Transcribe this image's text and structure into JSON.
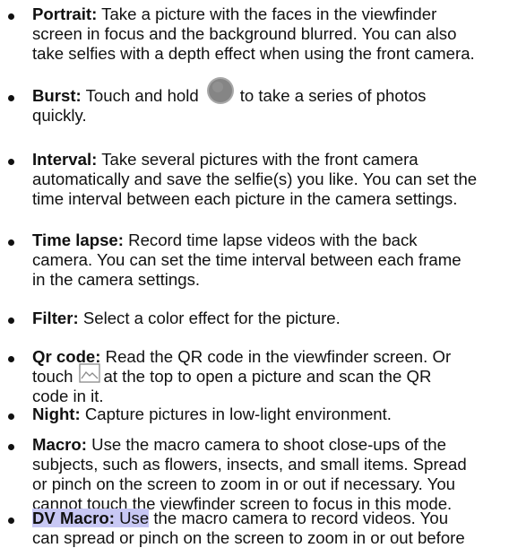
{
  "items": [
    {
      "term": "Portrait:",
      "lines": [
        "Take a picture with the faces in the viewfinder",
        "screen in focus and the background blurred. You can also",
        "take selfies with a depth effect when using the front camera."
      ]
    },
    {
      "term": "Burst:",
      "l1_before": "Touch and hold",
      "icon": "shutter-button-icon",
      "l1_after": "to take a series of photos",
      "l2": "quickly."
    },
    {
      "term": "Interval:",
      "lines": [
        "Take several pictures with the front camera",
        "automatically and save the selfie(s) you like. You can set the",
        "time interval between each picture in the camera settings."
      ]
    },
    {
      "term": "Time lapse:",
      "lines": [
        "Record time lapse videos with the back",
        "camera. You can set the time interval between each frame",
        "in the camera settings."
      ]
    },
    {
      "term": "Filter:",
      "lines": [
        "Select a color effect for the picture."
      ]
    },
    {
      "term": "Qr code:",
      "l1": "Read the QR code in the viewfinder screen. Or",
      "l2_before": "touch",
      "icon": "open-picture-icon",
      "l2_after": "at the top to open a picture and scan the QR",
      "l3": "code in it."
    },
    {
      "term": "Night:",
      "lines": [
        "Capture pictures in low-light environment."
      ]
    },
    {
      "term": "Macro:",
      "lines": [
        "Use the macro camera to shoot close-ups of the",
        "subjects, such as flowers, insects, and small items. Spread",
        "or pinch on the screen to zoom in or out if necessary. You",
        "cannot touch the viewfinder screen to focus in this mode."
      ]
    },
    {
      "term": "DV Macro:",
      "l1_highlight": "Use",
      "l1_rest": "the macro camera to record videos. You",
      "l2": "can spread or pinch on the screen to zoom in or out before"
    }
  ],
  "colors": {
    "text": "#111111",
    "highlight": "#c8c8f4",
    "shutter_outer": "#9a9a9a",
    "shutter_inner": "#7a7a7a",
    "icon_stroke": "#8a8a8a"
  }
}
